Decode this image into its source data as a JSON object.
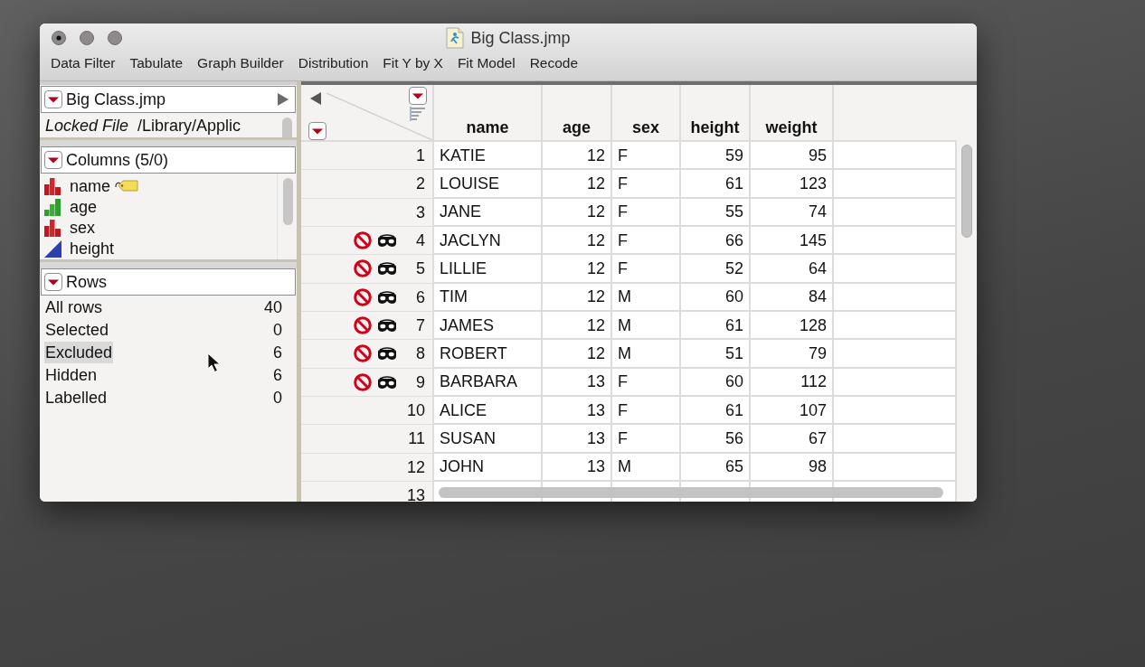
{
  "window": {
    "title": "Big Class.jmp"
  },
  "toolbar": [
    "Data Filter",
    "Tabulate",
    "Graph Builder",
    "Distribution",
    "Fit Y by X",
    "Fit Model",
    "Recode"
  ],
  "table_panel": {
    "title": "Big Class.jmp",
    "status": "Locked File",
    "path": "/Library/Applic"
  },
  "columns_panel": {
    "title": "Columns (5/0)",
    "columns": [
      {
        "name": "name",
        "kind": "nominal",
        "labelled": true
      },
      {
        "name": "age",
        "kind": "ordinal",
        "labelled": false
      },
      {
        "name": "sex",
        "kind": "nominal",
        "labelled": false
      },
      {
        "name": "height",
        "kind": "continuous",
        "labelled": false
      }
    ]
  },
  "rows_panel": {
    "title": "Rows",
    "items": [
      {
        "label": "All rows",
        "count": "40",
        "selected": false
      },
      {
        "label": "Selected",
        "count": "0",
        "selected": false
      },
      {
        "label": "Excluded",
        "count": "6",
        "selected": true
      },
      {
        "label": "Hidden",
        "count": "6",
        "selected": false
      },
      {
        "label": "Labelled",
        "count": "0",
        "selected": false
      }
    ]
  },
  "data_grid": {
    "columns": [
      {
        "name": "name",
        "kind": "text"
      },
      {
        "name": "age",
        "kind": "number"
      },
      {
        "name": "sex",
        "kind": "text"
      },
      {
        "name": "height",
        "kind": "number"
      },
      {
        "name": "weight",
        "kind": "number"
      }
    ],
    "rows": [
      {
        "number": "1",
        "excluded": false,
        "hidden": false,
        "cells": [
          "KATIE",
          "12",
          "F",
          "59",
          "95"
        ]
      },
      {
        "number": "2",
        "excluded": false,
        "hidden": false,
        "cells": [
          "LOUISE",
          "12",
          "F",
          "61",
          "123"
        ]
      },
      {
        "number": "3",
        "excluded": false,
        "hidden": false,
        "cells": [
          "JANE",
          "12",
          "F",
          "55",
          "74"
        ]
      },
      {
        "number": "4",
        "excluded": true,
        "hidden": true,
        "cells": [
          "JACLYN",
          "12",
          "F",
          "66",
          "145"
        ]
      },
      {
        "number": "5",
        "excluded": true,
        "hidden": true,
        "cells": [
          "LILLIE",
          "12",
          "F",
          "52",
          "64"
        ]
      },
      {
        "number": "6",
        "excluded": true,
        "hidden": true,
        "cells": [
          "TIM",
          "12",
          "M",
          "60",
          "84"
        ]
      },
      {
        "number": "7",
        "excluded": true,
        "hidden": true,
        "cells": [
          "JAMES",
          "12",
          "M",
          "61",
          "128"
        ]
      },
      {
        "number": "8",
        "excluded": true,
        "hidden": true,
        "cells": [
          "ROBERT",
          "12",
          "M",
          "51",
          "79"
        ]
      },
      {
        "number": "9",
        "excluded": true,
        "hidden": true,
        "cells": [
          "BARBARA",
          "13",
          "F",
          "60",
          "112"
        ]
      },
      {
        "number": "10",
        "excluded": false,
        "hidden": false,
        "cells": [
          "ALICE",
          "13",
          "F",
          "61",
          "107"
        ]
      },
      {
        "number": "11",
        "excluded": false,
        "hidden": false,
        "cells": [
          "SUSAN",
          "13",
          "F",
          "56",
          "67"
        ]
      },
      {
        "number": "12",
        "excluded": false,
        "hidden": false,
        "cells": [
          "JOHN",
          "13",
          "M",
          "65",
          "98"
        ]
      },
      {
        "number": "13",
        "excluded": false,
        "hidden": false
      }
    ]
  }
}
